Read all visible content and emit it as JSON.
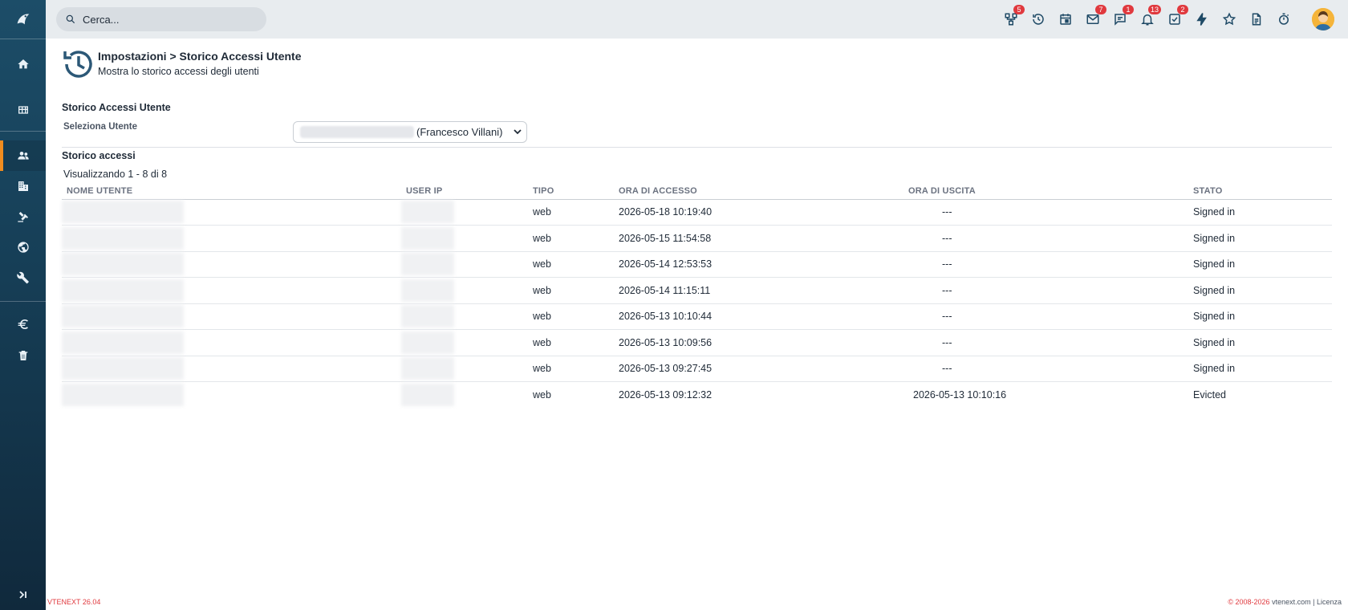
{
  "search": {
    "placeholder": "Cerca..."
  },
  "topbar": {
    "icons": [
      {
        "name": "process-icon",
        "badge": "5"
      },
      {
        "name": "history-icon",
        "badge": ""
      },
      {
        "name": "calendar-icon",
        "badge": ""
      },
      {
        "name": "mail-icon",
        "badge": "7"
      },
      {
        "name": "chat-icon",
        "badge": "1"
      },
      {
        "name": "bell-icon",
        "badge": "13"
      },
      {
        "name": "tasks-icon",
        "badge": "2"
      },
      {
        "name": "lightning-icon",
        "badge": ""
      },
      {
        "name": "star-icon",
        "badge": ""
      },
      {
        "name": "document-icon",
        "badge": ""
      },
      {
        "name": "timer-icon",
        "badge": ""
      }
    ]
  },
  "sidebar": {
    "items": [
      {
        "name": "home-icon"
      },
      {
        "name": "grid-icon"
      },
      {
        "name": "users-icon",
        "active": true
      },
      {
        "name": "building-icon"
      },
      {
        "name": "gavel-icon"
      },
      {
        "name": "globe-icon"
      },
      {
        "name": "wrench-icon"
      },
      {
        "name": "euro-icon"
      },
      {
        "name": "trash-icon"
      }
    ]
  },
  "header": {
    "title": "Impostazioni > Storico Accessi Utente",
    "subtitle": "Mostra lo storico accessi degli utenti"
  },
  "section": {
    "title": "Storico Accessi Utente",
    "user_label": "Seleziona Utente",
    "user_value": "(Francesco Villani)",
    "history_title": "Storico accessi",
    "count_text": "Visualizzando 1 - 8 di 8"
  },
  "table": {
    "columns": [
      "NOME UTENTE",
      "USER IP",
      "TIPO",
      "ORA DI ACCESSO",
      "ORA DI USCITA",
      "STATO"
    ],
    "rows": [
      {
        "tipo": "web",
        "accesso": "2026-05-18 10:19:40",
        "uscita": "---",
        "stato": "Signed in"
      },
      {
        "tipo": "web",
        "accesso": "2026-05-15 11:54:58",
        "uscita": "---",
        "stato": "Signed in"
      },
      {
        "tipo": "web",
        "accesso": "2026-05-14 12:53:53",
        "uscita": "---",
        "stato": "Signed in"
      },
      {
        "tipo": "web",
        "accesso": "2026-05-14 11:15:11",
        "uscita": "---",
        "stato": "Signed in"
      },
      {
        "tipo": "web",
        "accesso": "2026-05-13 10:10:44",
        "uscita": "---",
        "stato": "Signed in"
      },
      {
        "tipo": "web",
        "accesso": "2026-05-13 10:09:56",
        "uscita": "---",
        "stato": "Signed in"
      },
      {
        "tipo": "web",
        "accesso": "2026-05-13 09:27:45",
        "uscita": "---",
        "stato": "Signed in"
      },
      {
        "tipo": "web",
        "accesso": "2026-05-13 09:12:32",
        "uscita": "2026-05-13 10:10:16",
        "stato": "Evicted"
      }
    ]
  },
  "footer": {
    "version": "VTENEXT 26.04",
    "copyright": "© 2008-2026",
    "site": "vtenext.com",
    "sep": "|",
    "license": "Licenza"
  },
  "colors": {
    "accent": "#f08c1f",
    "badge": "#e0393e",
    "sidebar": "#163e56"
  }
}
